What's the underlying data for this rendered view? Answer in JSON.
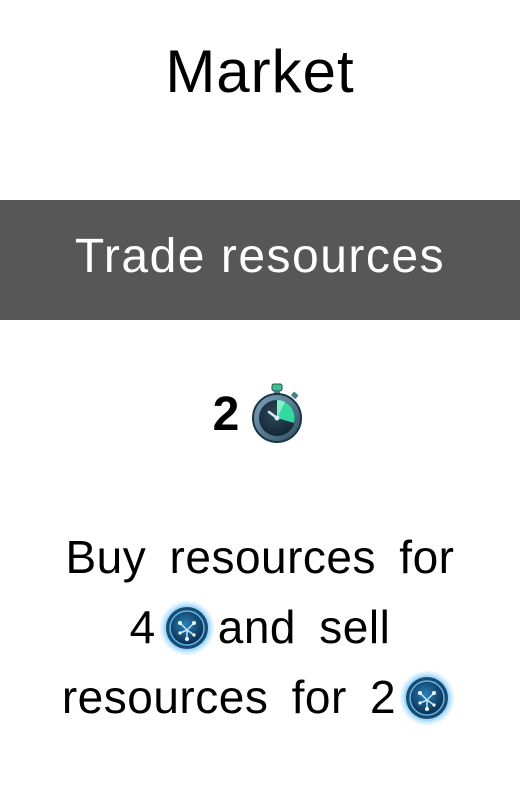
{
  "card": {
    "title": "Market",
    "banner": "Trade resources",
    "cost": {
      "value": "2",
      "icon": "stopwatch-icon"
    },
    "description": {
      "line1": "Buy resources for",
      "line2_value": "4",
      "line2_text": "and sell",
      "line3_text": "resources for 2",
      "icon": "resource-coin-icon"
    }
  },
  "colors": {
    "banner_background": "#575757",
    "banner_text": "#ffffff",
    "text": "#000000",
    "coin_glow": "#3fa7ff"
  }
}
